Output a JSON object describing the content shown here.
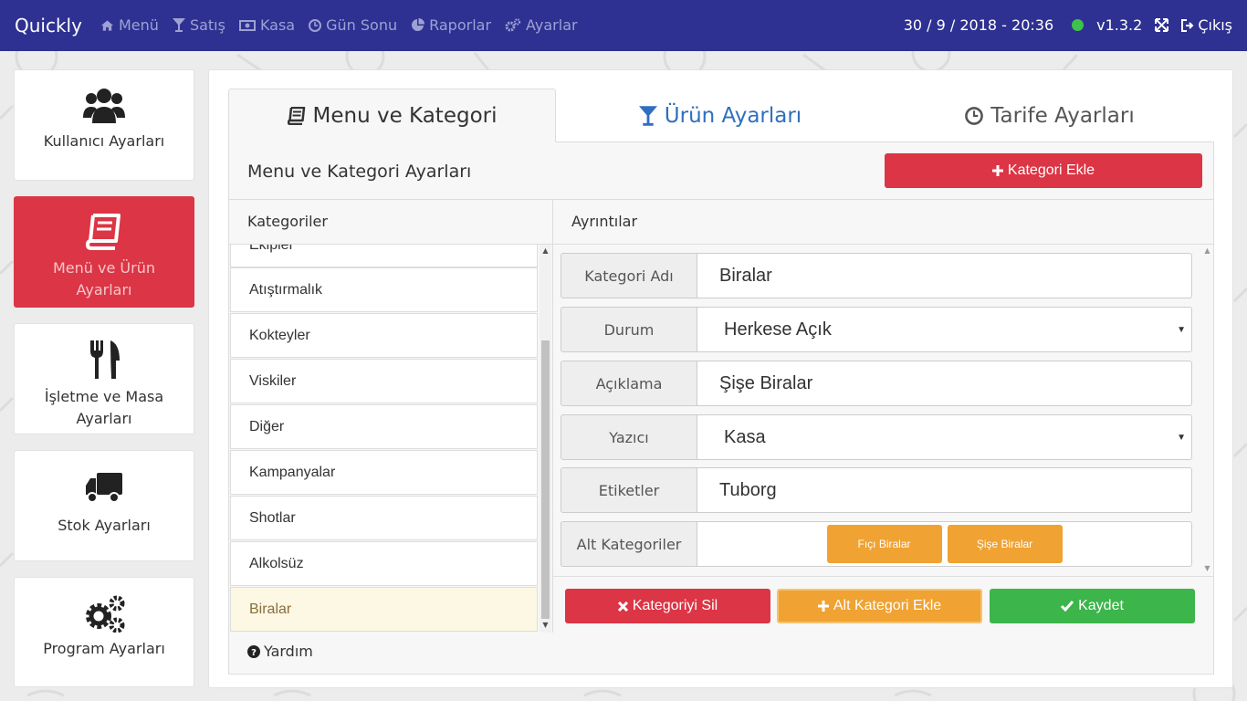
{
  "app": {
    "brand": "Quickly"
  },
  "nav": {
    "items": [
      {
        "label": "Menü",
        "icon": "home-icon"
      },
      {
        "label": "Satış",
        "icon": "cocktail-glass-icon"
      },
      {
        "label": "Kasa",
        "icon": "money-bill-icon"
      },
      {
        "label": "Gün Sonu",
        "icon": "clock-icon"
      },
      {
        "label": "Raporlar",
        "icon": "pie-chart-icon"
      },
      {
        "label": "Ayarlar",
        "icon": "gears-icon"
      }
    ],
    "datetime": "30 / 9 / 2018 - 20:36",
    "status_color": "#3fc24b",
    "version": "v1.3.2",
    "logout_label": "Çıkış"
  },
  "sidebar": {
    "items": [
      {
        "label": "Kullanıcı Ayarları",
        "icon": "users-icon",
        "active": false
      },
      {
        "label": "Menü ve Ürün Ayarları",
        "icon": "book-icon",
        "active": true
      },
      {
        "label": "İşletme ve Masa Ayarları",
        "icon": "utensils-icon",
        "active": false
      },
      {
        "label": "Stok Ayarları",
        "icon": "truck-icon",
        "active": false
      },
      {
        "label": "Program Ayarları",
        "icon": "gears-icon",
        "active": false
      }
    ]
  },
  "tabs": [
    {
      "label": "Menu ve Kategori",
      "icon": "book-icon",
      "active": true
    },
    {
      "label": "Ürün Ayarları",
      "icon": "cocktail-glass-icon",
      "active": false
    },
    {
      "label": "Tarife Ayarları",
      "icon": "clock-icon",
      "active": false
    }
  ],
  "panel": {
    "title": "Menu ve Kategori Ayarları",
    "add_category_label": "Kategori Ekle"
  },
  "categories": {
    "header": "Kategoriler",
    "items": [
      "Ekipler",
      "Atıştırmalık",
      "Kokteyler",
      "Viskiler",
      "Diğer",
      "Kampanyalar",
      "Shotlar",
      "Alkolsüz",
      "Biralar"
    ],
    "selected": "Biralar"
  },
  "details": {
    "header": "Ayrıntılar",
    "fields": {
      "name": {
        "label": "Kategori Adı",
        "value": "Biralar"
      },
      "status": {
        "label": "Durum",
        "value": "Herkese Açık"
      },
      "description": {
        "label": "Açıklama",
        "value": "Şişe Biralar"
      },
      "printer": {
        "label": "Yazıcı",
        "value": "Kasa"
      },
      "tags": {
        "label": "Etiketler",
        "value": "Tuborg"
      },
      "subcategories": {
        "label": "Alt Kategoriler",
        "items": [
          "Fıçı Biralar",
          "Şişe Biralar"
        ]
      }
    }
  },
  "actions": {
    "delete_label": "Kategoriyi Sil",
    "add_sub_label": "Alt Kategori Ekle",
    "save_label": "Kaydet"
  },
  "help_label": "Yardım",
  "colors": {
    "navbar": "#2e3191",
    "danger": "#dc3545",
    "warning": "#f0a232",
    "success": "#3cb54a",
    "selected_row": "#fcf8e3"
  }
}
